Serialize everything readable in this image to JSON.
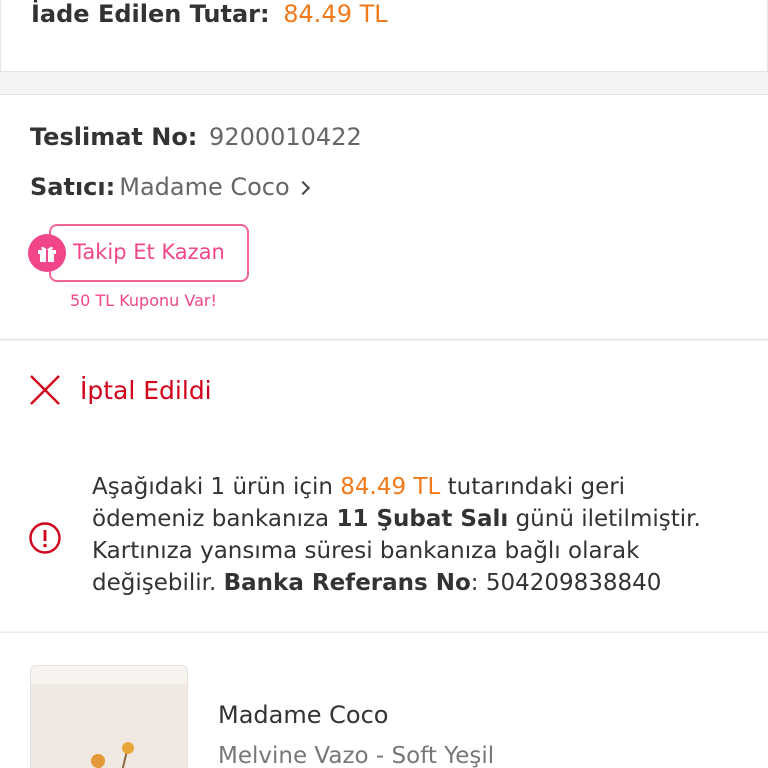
{
  "refund": {
    "label": "İade Edilen Tutar:",
    "value": "84.49 TL"
  },
  "delivery": {
    "number_label": "Teslimat No:",
    "number_value": "9200010422",
    "seller_label": "Satıcı:",
    "seller_value": "Madame Coco",
    "follow_button": "Takip Et Kazan",
    "coupon_text": "50 TL Kuponu Var!"
  },
  "status": {
    "label": "İptal Edildi",
    "info": {
      "p1": "Aşağıdaki 1 ürün için ",
      "amount": "84.49 TL",
      "p2": " tutarındaki geri ödemeniz bankanıza ",
      "date": "11 Şubat Salı",
      "p3": " günü iletilmiştir. Kartınıza yansıma süresi bankanıza bağlı olarak değişebilir. ",
      "ref_label": "Banka Referans No",
      "p4": ": ",
      "ref_value": "504209838840"
    }
  },
  "product": {
    "brand": "Madame Coco",
    "name": "Melvine Vazo - Soft Yeşil"
  },
  "colors": {
    "accent_orange": "#f27a1a",
    "pink": "#f1468a",
    "cancel_red": "#d0021b"
  },
  "icons": [
    "gift-icon",
    "chevron-right-icon",
    "close-icon",
    "info-icon"
  ]
}
